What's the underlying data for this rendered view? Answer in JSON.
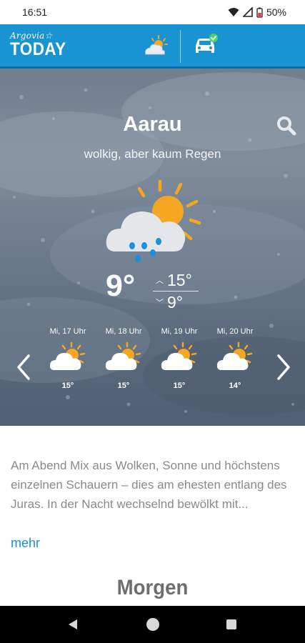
{
  "status_bar": {
    "time": "16:51",
    "battery": "50%"
  },
  "app_bar": {
    "logo_small": "Argovia☆",
    "logo_big": "TODAY"
  },
  "weather": {
    "city": "Aarau",
    "description": "wolkig, aber kaum Regen",
    "current_temp": "9°",
    "high": "15°",
    "low": "9°",
    "forecast": [
      {
        "time": "Mi, 17 Uhr",
        "temp": "15°",
        "icon": "sun-cloud-icon"
      },
      {
        "time": "Mi, 18 Uhr",
        "temp": "15°",
        "icon": "sun-cloud-icon"
      },
      {
        "time": "Mi, 19 Uhr",
        "temp": "15°",
        "icon": "sun-cloud-icon"
      },
      {
        "time": "Mi, 20 Uhr",
        "temp": "14°",
        "icon": "sun-cloud-icon"
      }
    ]
  },
  "article": {
    "text": "Am Abend Mix aus Wolken, Sonne und höchstens einzelnen Schauern – dies am ehesten entlang des Juras. In der Nacht wechselnd bewölkt mit...",
    "more": "mehr",
    "next_section_title": "Morgen"
  },
  "colors": {
    "appbar": "#1993d2",
    "link": "#1a8fd0",
    "sun": "#f5a623",
    "rain": "#1b8fe0"
  }
}
